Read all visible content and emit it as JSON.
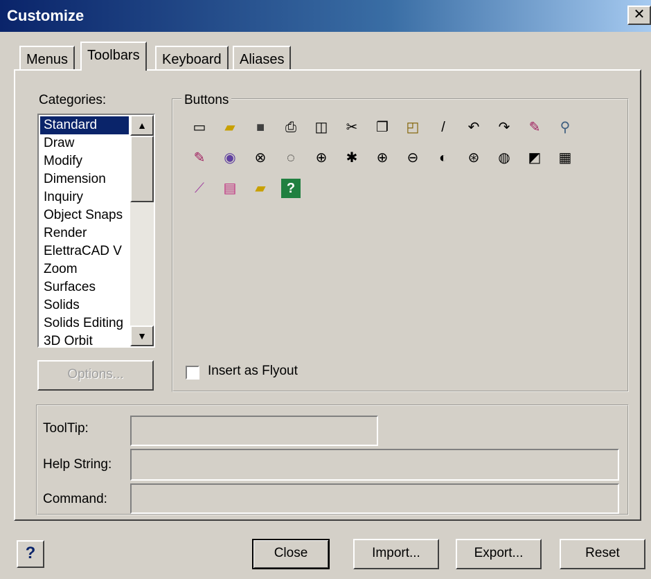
{
  "window": {
    "title": "Customize",
    "close_glyph": "✕"
  },
  "tabs": [
    {
      "label": "Menus"
    },
    {
      "label": "Toolbars"
    },
    {
      "label": "Keyboard"
    },
    {
      "label": "Aliases"
    }
  ],
  "categories": {
    "label": "Categories:",
    "selected": "Standard",
    "items": [
      "Standard",
      "Draw",
      "Modify",
      "Dimension",
      "Inquiry",
      "Object Snaps",
      "Render",
      "ElettraCAD V",
      "Zoom",
      "Surfaces",
      "Solids",
      "Solids Editing",
      "3D Orbit"
    ]
  },
  "options_button": "Options...",
  "buttons_group": {
    "label": "Buttons",
    "icons": [
      "new-icon",
      "open-icon",
      "save-icon",
      "print-icon",
      "preview-icon",
      "cut-icon",
      "copy-icon",
      "paste-icon",
      "match-properties-icon",
      "undo-icon",
      "redo-icon",
      "hyperlink-icon",
      "zoom-realtime-icon",
      "insert-hyperlink-icon",
      "zoom-window-icon",
      "zoom-x-icon",
      "zoom-circle-icon",
      "zoom-in-small-icon",
      "zoom-star-icon",
      "zoom-plus-icon",
      "zoom-minus-icon",
      "zoom-d-icon",
      "zoom-center-icon",
      "zoom-extents-icon",
      "named-views-icon",
      "ucs-icon",
      "properties-brush-icon",
      "layer-color-icon",
      "folder-icon",
      "help-icon"
    ]
  },
  "insert_flyout": {
    "label": "Insert as Flyout",
    "checked": false
  },
  "fields": {
    "tooltip": {
      "label": "ToolTip:",
      "value": ""
    },
    "help_string": {
      "label": "Help String:",
      "value": ""
    },
    "command": {
      "label": "Command:",
      "value": ""
    }
  },
  "footer": {
    "help": "?",
    "close": "Close",
    "import": "Import...",
    "export": "Export...",
    "reset": "Reset"
  }
}
